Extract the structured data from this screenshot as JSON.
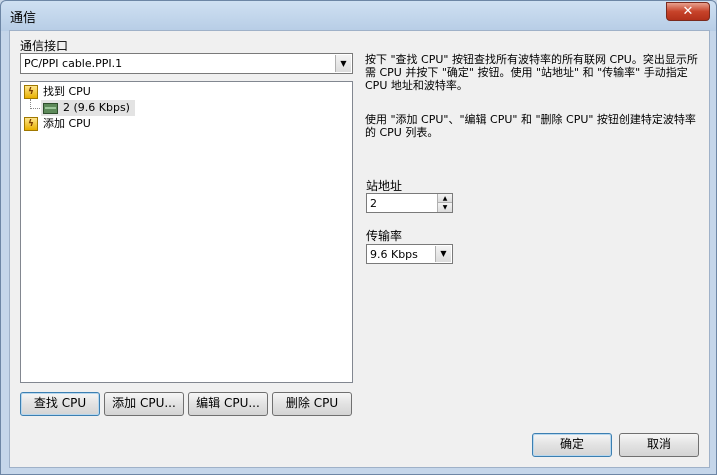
{
  "window": {
    "title": "通信",
    "close_glyph": "✕"
  },
  "interface": {
    "label": "通信接口",
    "selected": "PC/PPI cable.PPI.1"
  },
  "tree": [
    {
      "label": "找到 CPU",
      "icon": "lightning-icon"
    },
    {
      "label": "2 (9.6 Kbps)",
      "icon": "network-card-icon"
    },
    {
      "label": "添加 CPU",
      "icon": "lightning-icon"
    }
  ],
  "buttons": {
    "find_cpu": "查找 CPU",
    "add_cpu": "添加 CPU...",
    "edit_cpu": "编辑 CPU...",
    "delete_cpu": "删除 CPU",
    "ok": "确定",
    "cancel": "取消"
  },
  "description": {
    "line1": "按下 \"查找 CPU\" 按钮查找所有波特率的所有联网 CPU。突出显示所需 CPU 并按下 \"确定\" 按钮。使用 \"站地址\" 和 \"传输率\" 手动指定 CPU 地址和波特率。",
    "line2": "使用 \"添加 CPU\"、\"编辑 CPU\" 和 \"删除 CPU\" 按钮创建特定波特率的 CPU 列表。"
  },
  "station": {
    "label": "站地址",
    "value": "2"
  },
  "baud": {
    "label": "传输率",
    "selected": "9.6 Kbps"
  },
  "colors": {
    "title_bg": "#c5d6ea",
    "client_bg": "#f0f0f0",
    "close_red": "#c7432a"
  }
}
